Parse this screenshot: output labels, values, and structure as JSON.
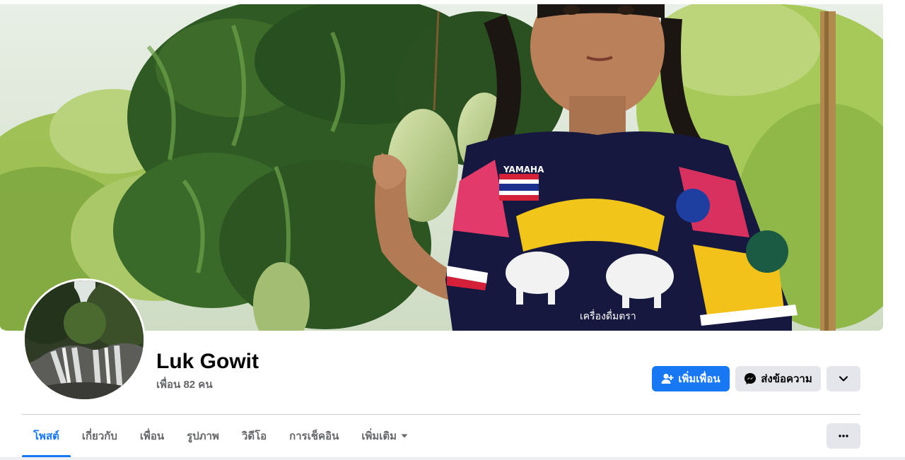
{
  "profile": {
    "name": "Luk Gowit",
    "friend_count": "เพื่อน 82 คน"
  },
  "cover": {
    "shirt_brand": "YAMAHA",
    "shirt_text": "เครื่องดื่มตรา"
  },
  "actions": {
    "add_friend_label": "เพิ่มเพื่อน",
    "message_label": "ส่งข้อความ",
    "dropdown_icon": "chevron-down-icon"
  },
  "tabs": [
    {
      "label": "โพสต์",
      "active": true
    },
    {
      "label": "เกี่ยวกับ",
      "active": false
    },
    {
      "label": "เพื่อน",
      "active": false
    },
    {
      "label": "รูปภาพ",
      "active": false
    },
    {
      "label": "วิดีโอ",
      "active": false
    },
    {
      "label": "การเช็คอิน",
      "active": false
    },
    {
      "label": "เพิ่มเติม",
      "active": false
    }
  ],
  "more_icon": "ellipsis-icon",
  "colors": {
    "accent": "#1877f2",
    "secondary_bg": "#e4e6eb",
    "muted_text": "#65676b"
  }
}
